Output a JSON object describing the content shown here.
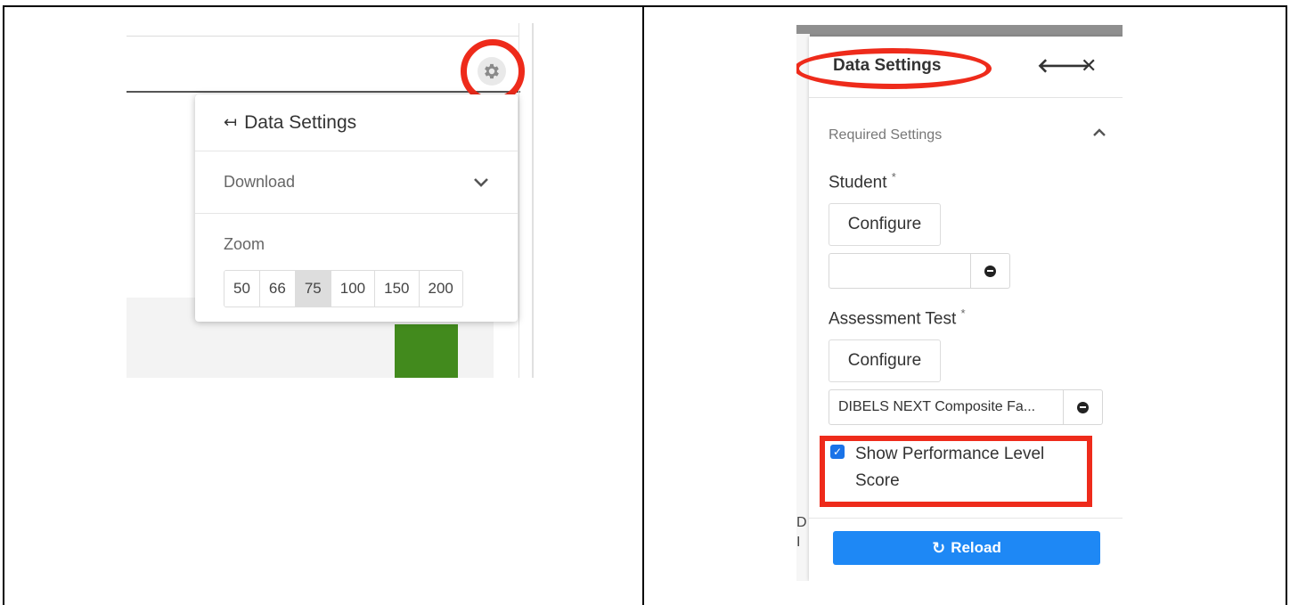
{
  "left_panel": {
    "dropdown": {
      "title_icon": "arrow-left-to-line-icon",
      "title": "Data Settings",
      "download_label": "Download",
      "download_icon": "chevron-down-icon",
      "zoom_label": "Zoom",
      "zoom_options": [
        "50",
        "66",
        "75",
        "100",
        "150",
        "200"
      ],
      "zoom_selected": "75"
    },
    "gear_icon": "gear-icon",
    "highlight_color": "#ee2b1b",
    "bar_color": "#428a1d"
  },
  "right_panel": {
    "title": "Data Settings",
    "back_icon": "arrow-left-icon",
    "close_icon": "close-icon",
    "section_label": "Required Settings",
    "section_icon": "chevron-up-icon",
    "student": {
      "label": "Student",
      "required_mark": "*",
      "configure_label": "Configure",
      "value": ""
    },
    "assessment": {
      "label": "Assessment Test",
      "required_mark": "*",
      "configure_label": "Configure",
      "value": "DIBELS NEXT Composite Fa..."
    },
    "show_performance": {
      "label": "Show Performance Level Score",
      "checked": true
    },
    "background_text": [
      "D",
      "I"
    ],
    "reload_label": "Reload",
    "reload_icon": "reload-icon",
    "accent_color": "#1e88f5"
  }
}
